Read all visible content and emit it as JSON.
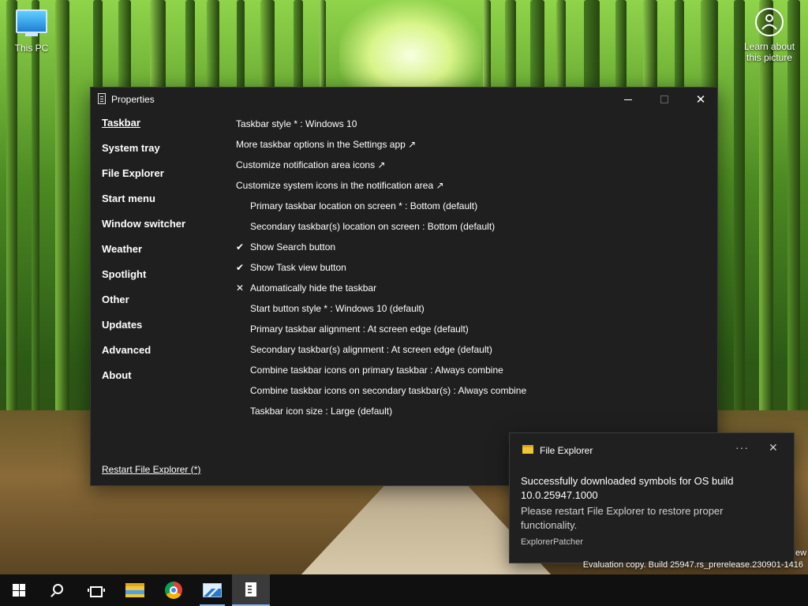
{
  "desktop": {
    "icons": [
      {
        "label": "This PC"
      },
      {
        "label": "Learn about this picture"
      }
    ],
    "watermark": "Evaluation copy. Build 25947.rs_prerelease.230901-1416",
    "watermark_tail": "ew"
  },
  "window": {
    "title": "Properties",
    "nav": [
      {
        "label": "Taskbar",
        "active": true
      },
      {
        "label": "System tray"
      },
      {
        "label": "File Explorer"
      },
      {
        "label": "Start menu"
      },
      {
        "label": "Window switcher"
      },
      {
        "label": "Weather"
      },
      {
        "label": "Spotlight"
      },
      {
        "label": "Other"
      },
      {
        "label": "Updates"
      },
      {
        "label": "Advanced"
      },
      {
        "label": "About"
      }
    ],
    "restart_link": "Restart File Explorer (*)",
    "settings": [
      {
        "mark": "",
        "indent": false,
        "text": "Taskbar style * : Windows 10"
      },
      {
        "mark": "",
        "indent": false,
        "text": "More taskbar options in the Settings app ↗"
      },
      {
        "mark": "",
        "indent": false,
        "text": "Customize notification area icons ↗"
      },
      {
        "mark": "",
        "indent": false,
        "text": "Customize system icons in the notification area ↗"
      },
      {
        "mark": "",
        "indent": true,
        "text": "Primary taskbar location on screen * : Bottom (default)"
      },
      {
        "mark": "",
        "indent": true,
        "text": "Secondary taskbar(s) location on screen : Bottom (default)"
      },
      {
        "mark": "✔",
        "indent": true,
        "text": "Show Search button"
      },
      {
        "mark": "✔",
        "indent": true,
        "text": "Show Task view button"
      },
      {
        "mark": "✕",
        "indent": true,
        "text": "Automatically hide the taskbar"
      },
      {
        "mark": "",
        "indent": true,
        "text": "Start button style * : Windows 10 (default)"
      },
      {
        "mark": "",
        "indent": true,
        "text": "Primary taskbar alignment : At screen edge (default)"
      },
      {
        "mark": "",
        "indent": true,
        "text": "Secondary taskbar(s) alignment : At screen edge (default)"
      },
      {
        "mark": "",
        "indent": true,
        "text": "Combine taskbar icons on primary taskbar : Always combine"
      },
      {
        "mark": "",
        "indent": true,
        "text": "Combine taskbar icons on secondary taskbar(s) : Always combine"
      },
      {
        "mark": "",
        "indent": true,
        "text": "Taskbar icon size : Large (default)"
      }
    ]
  },
  "toast": {
    "app_name": "File Explorer",
    "more": "···",
    "close": "✕",
    "headline": "Successfully downloaded symbols for OS build 10.0.25947.1000",
    "body": "Please restart File Explorer to restore proper functionality.",
    "source": "ExplorerPatcher"
  },
  "taskbar": {
    "items": [
      "start-icon",
      "search-icon",
      "task-view-icon",
      "file-explorer-icon",
      "chrome-icon",
      "performance-monitor-icon",
      "properties-icon"
    ],
    "accent": "#7ab7ff"
  }
}
